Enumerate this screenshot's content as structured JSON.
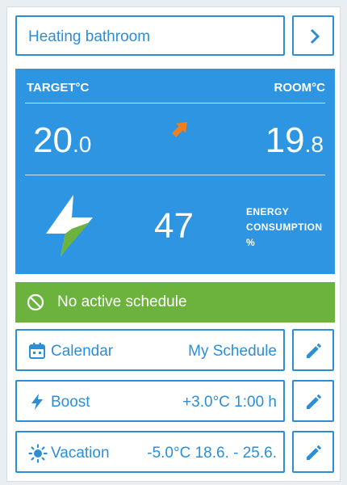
{
  "header": {
    "title": "Heating bathroom"
  },
  "panel": {
    "target_label": "TARGET°C",
    "room_label": "ROOM°C",
    "target_int": "20",
    "target_dec": ".0",
    "room_int": "19",
    "room_dec": ".8",
    "energy_value": "47",
    "energy_label_1": "ENERGY",
    "energy_label_2": "CONSUMPTION",
    "energy_label_3": "%"
  },
  "schedule": {
    "status": "No active schedule"
  },
  "rows": [
    {
      "label": "Calendar",
      "value": "My Schedule",
      "icon": "calendar-icon"
    },
    {
      "label": "Boost",
      "value": "+3.0°C 1:00 h",
      "icon": "bolt-icon"
    },
    {
      "label": "Vacation",
      "value": "-5.0°C 18.6. - 25.6.",
      "icon": "sun-icon"
    }
  ],
  "colors": {
    "accent": "#2c8fd6",
    "panel": "#2d95e2",
    "schedule_green": "#6cb33e",
    "arrow_orange": "#f07f1e",
    "bolt_green": "#6cb33e"
  }
}
